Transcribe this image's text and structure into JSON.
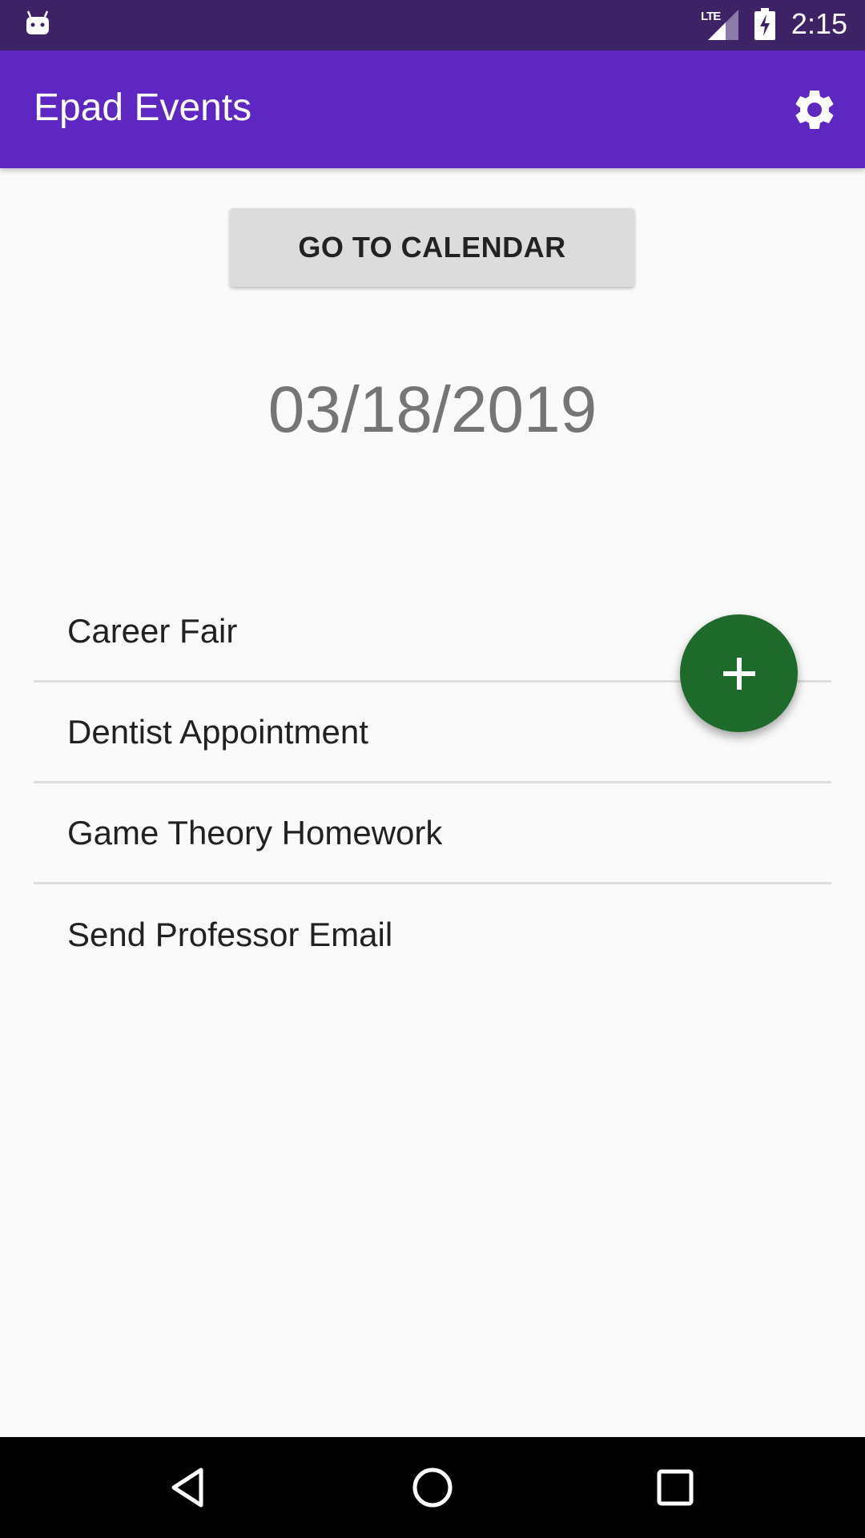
{
  "status_bar": {
    "network_label": "LTE",
    "time": "2:15",
    "icons": [
      "android-icon",
      "signal-icon",
      "battery-charging-icon"
    ]
  },
  "app_bar": {
    "title": "Epad Events",
    "settings_icon": "gear-icon",
    "color": "#5e27c2"
  },
  "main": {
    "calendar_button_label": "GO TO CALENDAR",
    "date": "03/18/2019",
    "events": [
      {
        "label": "Career Fair"
      },
      {
        "label": "Dentist Appointment"
      },
      {
        "label": "Game Theory Homework"
      },
      {
        "label": "Send Professor Email"
      }
    ],
    "fab_icon": "plus-icon",
    "fab_color": "#1e6a2a"
  },
  "nav_bar": {
    "buttons": [
      "back-icon",
      "home-icon",
      "recents-icon"
    ]
  }
}
